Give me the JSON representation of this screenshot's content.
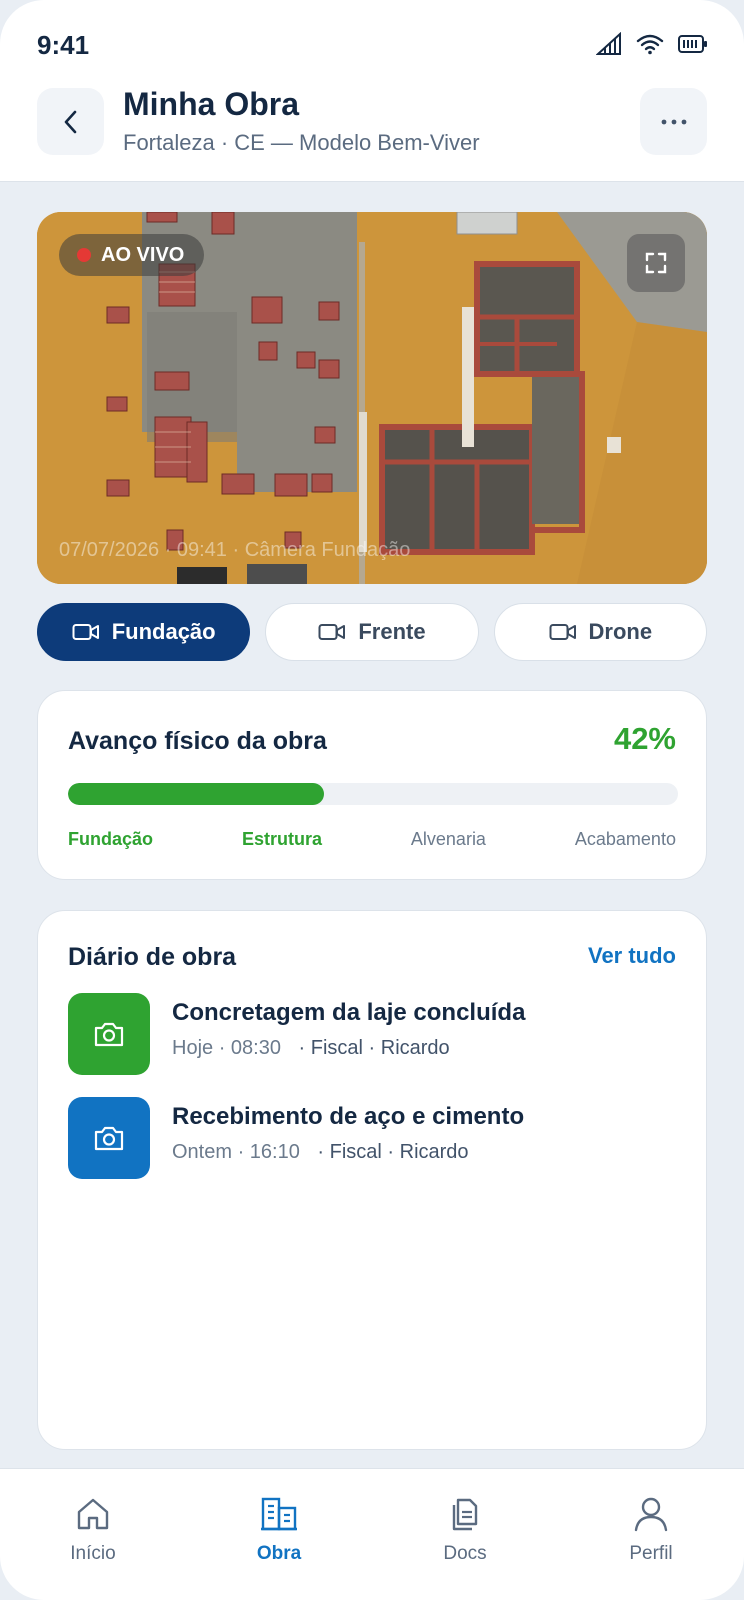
{
  "status_bar": {
    "time": "9:41"
  },
  "header": {
    "title": "Minha Obra",
    "subtitle": "Fortaleza · CE — Modelo Bem-Viver"
  },
  "camera": {
    "live_label": "AO VIVO",
    "caption": "07/07/2026 · 09:41 · Câmera Fundação",
    "tabs": [
      {
        "label": "Fundação",
        "active": true
      },
      {
        "label": "Frente",
        "active": false
      },
      {
        "label": "Drone",
        "active": false
      }
    ]
  },
  "progress": {
    "title": "Avanço físico da obra",
    "percent_label": "42%",
    "percent": 42,
    "stages": [
      {
        "label": "Fundação",
        "done": true
      },
      {
        "label": "Estrutura",
        "done": true
      },
      {
        "label": "Alvenaria",
        "done": false
      },
      {
        "label": "Acabamento",
        "done": false
      }
    ]
  },
  "diary": {
    "title": "Diário de obra",
    "see_all": "Ver tudo",
    "entries": [
      {
        "title": "Concretagem da laje concluída",
        "when": "Hoje · 08:30",
        "who": "· Fiscal · Ricardo",
        "color": "#2fa331",
        "icon": "camera-icon"
      },
      {
        "title": "Recebimento de aço e cimento",
        "when": "Ontem · 16:10",
        "who": "· Fiscal · Ricardo",
        "color": "#1173c2",
        "icon": "camera-icon"
      }
    ]
  },
  "nav": {
    "items": [
      {
        "label": "Início",
        "icon": "home-icon",
        "active": false
      },
      {
        "label": "Obra",
        "icon": "building-icon",
        "active": true
      },
      {
        "label": "Docs",
        "icon": "documents-icon",
        "active": false
      },
      {
        "label": "Perfil",
        "icon": "user-icon",
        "active": false
      }
    ]
  },
  "colors": {
    "primary": "#0d3b7a",
    "accent": "#1173c2",
    "success": "#2fa331",
    "live": "#e53935"
  }
}
